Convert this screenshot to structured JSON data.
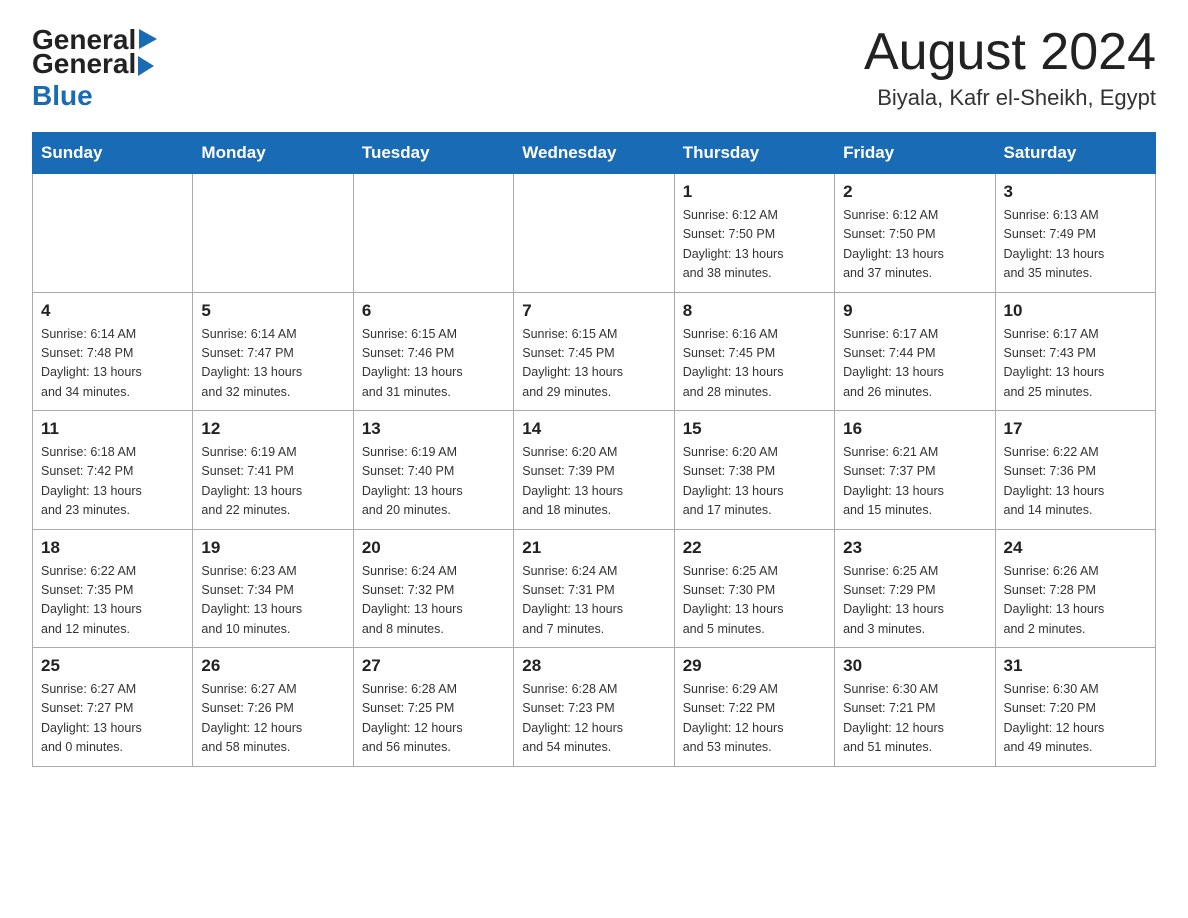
{
  "header": {
    "logo_general": "General",
    "logo_blue": "Blue",
    "month_title": "August 2024",
    "location": "Biyala, Kafr el-Sheikh, Egypt"
  },
  "weekdays": [
    "Sunday",
    "Monday",
    "Tuesday",
    "Wednesday",
    "Thursday",
    "Friday",
    "Saturday"
  ],
  "weeks": [
    [
      {
        "day": "",
        "info": ""
      },
      {
        "day": "",
        "info": ""
      },
      {
        "day": "",
        "info": ""
      },
      {
        "day": "",
        "info": ""
      },
      {
        "day": "1",
        "info": "Sunrise: 6:12 AM\nSunset: 7:50 PM\nDaylight: 13 hours\nand 38 minutes."
      },
      {
        "day": "2",
        "info": "Sunrise: 6:12 AM\nSunset: 7:50 PM\nDaylight: 13 hours\nand 37 minutes."
      },
      {
        "day": "3",
        "info": "Sunrise: 6:13 AM\nSunset: 7:49 PM\nDaylight: 13 hours\nand 35 minutes."
      }
    ],
    [
      {
        "day": "4",
        "info": "Sunrise: 6:14 AM\nSunset: 7:48 PM\nDaylight: 13 hours\nand 34 minutes."
      },
      {
        "day": "5",
        "info": "Sunrise: 6:14 AM\nSunset: 7:47 PM\nDaylight: 13 hours\nand 32 minutes."
      },
      {
        "day": "6",
        "info": "Sunrise: 6:15 AM\nSunset: 7:46 PM\nDaylight: 13 hours\nand 31 minutes."
      },
      {
        "day": "7",
        "info": "Sunrise: 6:15 AM\nSunset: 7:45 PM\nDaylight: 13 hours\nand 29 minutes."
      },
      {
        "day": "8",
        "info": "Sunrise: 6:16 AM\nSunset: 7:45 PM\nDaylight: 13 hours\nand 28 minutes."
      },
      {
        "day": "9",
        "info": "Sunrise: 6:17 AM\nSunset: 7:44 PM\nDaylight: 13 hours\nand 26 minutes."
      },
      {
        "day": "10",
        "info": "Sunrise: 6:17 AM\nSunset: 7:43 PM\nDaylight: 13 hours\nand 25 minutes."
      }
    ],
    [
      {
        "day": "11",
        "info": "Sunrise: 6:18 AM\nSunset: 7:42 PM\nDaylight: 13 hours\nand 23 minutes."
      },
      {
        "day": "12",
        "info": "Sunrise: 6:19 AM\nSunset: 7:41 PM\nDaylight: 13 hours\nand 22 minutes."
      },
      {
        "day": "13",
        "info": "Sunrise: 6:19 AM\nSunset: 7:40 PM\nDaylight: 13 hours\nand 20 minutes."
      },
      {
        "day": "14",
        "info": "Sunrise: 6:20 AM\nSunset: 7:39 PM\nDaylight: 13 hours\nand 18 minutes."
      },
      {
        "day": "15",
        "info": "Sunrise: 6:20 AM\nSunset: 7:38 PM\nDaylight: 13 hours\nand 17 minutes."
      },
      {
        "day": "16",
        "info": "Sunrise: 6:21 AM\nSunset: 7:37 PM\nDaylight: 13 hours\nand 15 minutes."
      },
      {
        "day": "17",
        "info": "Sunrise: 6:22 AM\nSunset: 7:36 PM\nDaylight: 13 hours\nand 14 minutes."
      }
    ],
    [
      {
        "day": "18",
        "info": "Sunrise: 6:22 AM\nSunset: 7:35 PM\nDaylight: 13 hours\nand 12 minutes."
      },
      {
        "day": "19",
        "info": "Sunrise: 6:23 AM\nSunset: 7:34 PM\nDaylight: 13 hours\nand 10 minutes."
      },
      {
        "day": "20",
        "info": "Sunrise: 6:24 AM\nSunset: 7:32 PM\nDaylight: 13 hours\nand 8 minutes."
      },
      {
        "day": "21",
        "info": "Sunrise: 6:24 AM\nSunset: 7:31 PM\nDaylight: 13 hours\nand 7 minutes."
      },
      {
        "day": "22",
        "info": "Sunrise: 6:25 AM\nSunset: 7:30 PM\nDaylight: 13 hours\nand 5 minutes."
      },
      {
        "day": "23",
        "info": "Sunrise: 6:25 AM\nSunset: 7:29 PM\nDaylight: 13 hours\nand 3 minutes."
      },
      {
        "day": "24",
        "info": "Sunrise: 6:26 AM\nSunset: 7:28 PM\nDaylight: 13 hours\nand 2 minutes."
      }
    ],
    [
      {
        "day": "25",
        "info": "Sunrise: 6:27 AM\nSunset: 7:27 PM\nDaylight: 13 hours\nand 0 minutes."
      },
      {
        "day": "26",
        "info": "Sunrise: 6:27 AM\nSunset: 7:26 PM\nDaylight: 12 hours\nand 58 minutes."
      },
      {
        "day": "27",
        "info": "Sunrise: 6:28 AM\nSunset: 7:25 PM\nDaylight: 12 hours\nand 56 minutes."
      },
      {
        "day": "28",
        "info": "Sunrise: 6:28 AM\nSunset: 7:23 PM\nDaylight: 12 hours\nand 54 minutes."
      },
      {
        "day": "29",
        "info": "Sunrise: 6:29 AM\nSunset: 7:22 PM\nDaylight: 12 hours\nand 53 minutes."
      },
      {
        "day": "30",
        "info": "Sunrise: 6:30 AM\nSunset: 7:21 PM\nDaylight: 12 hours\nand 51 minutes."
      },
      {
        "day": "31",
        "info": "Sunrise: 6:30 AM\nSunset: 7:20 PM\nDaylight: 12 hours\nand 49 minutes."
      }
    ]
  ]
}
